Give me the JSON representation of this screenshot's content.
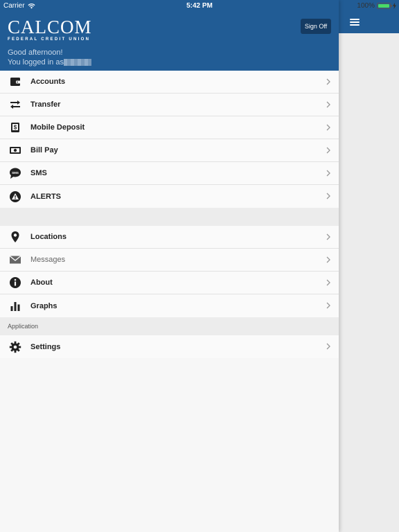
{
  "statusbar": {
    "carrier": "Carrier",
    "time": "5:42 PM",
    "battery": "100%",
    "battery_level": 1.0
  },
  "header": {
    "logo_main": "CALCOM",
    "logo_sub": "FEDERAL CREDIT UNION",
    "signoff_label": "Sign Off",
    "greeting": "Good afternoon!",
    "logged_in": "You logged in as"
  },
  "menu": {
    "group1": [
      {
        "label": "Accounts",
        "icon": "wallet-icon"
      },
      {
        "label": "Transfer",
        "icon": "transfer-arrows-icon"
      },
      {
        "label": "Mobile Deposit",
        "icon": "mobile-deposit-icon"
      },
      {
        "label": "Bill Pay",
        "icon": "money-bill-icon"
      },
      {
        "label": "SMS",
        "icon": "sms-bubble-icon"
      },
      {
        "label": "ALERTS",
        "icon": "alert-icon"
      }
    ],
    "group2": [
      {
        "label": "Locations",
        "icon": "map-pin-icon"
      },
      {
        "label": "Messages",
        "icon": "envelope-icon"
      },
      {
        "label": "About",
        "icon": "info-icon"
      },
      {
        "label": "Graphs",
        "icon": "bar-chart-icon"
      }
    ],
    "section_label": "Application",
    "group3": [
      {
        "label": "Settings",
        "icon": "gear-icon"
      }
    ]
  },
  "colors": {
    "brand_blue": "#215c95",
    "signoff_bg": "#153b63"
  }
}
